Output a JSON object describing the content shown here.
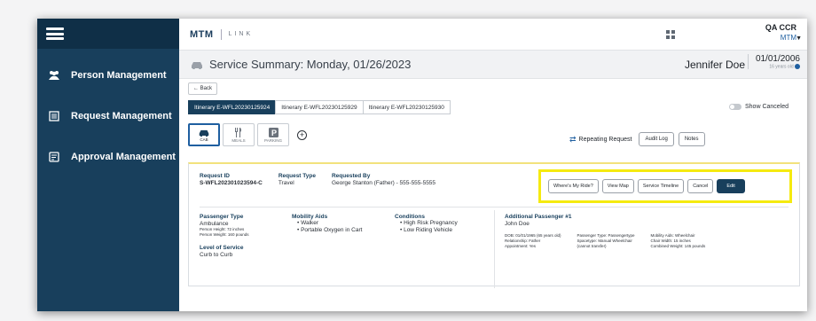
{
  "sidebar": {
    "items": [
      {
        "label": "Person Management",
        "icon": "people-icon"
      },
      {
        "label": "Request Management",
        "icon": "list-icon"
      },
      {
        "label": "Approval Management",
        "icon": "checklist-icon"
      }
    ]
  },
  "topbar": {
    "logo_brand": "MTM",
    "logo_product": "LINK",
    "user_name": "QA CCR",
    "user_org": "MTM"
  },
  "header": {
    "title": "Service Summary: Monday, 01/26/2023",
    "patient_name": "Jennifer Doe",
    "date": "01/01/2006",
    "age": "16 years old"
  },
  "back_label": "← Back",
  "tabs": [
    {
      "label": "Itinerary E-WFL20230125924",
      "active": true
    },
    {
      "label": "Itinerary E-WFL20230125929",
      "active": false
    },
    {
      "label": "Itinerary E-WFL20230125930",
      "active": false
    }
  ],
  "show_canceled_label": "Show Canceled",
  "services": [
    {
      "label": "CAB",
      "icon": "car-icon",
      "active": true
    },
    {
      "label": "MEALS",
      "icon": "utensils-icon",
      "active": false
    },
    {
      "label": "PARKING",
      "icon": "parking-icon",
      "active": false
    }
  ],
  "actions": {
    "repeating_request": "Repeating Request",
    "audit_log": "Audit Log",
    "notes": "Notes"
  },
  "request": {
    "id_label": "Request ID",
    "id_value": "S-WFL202301023594-C",
    "type_label": "Request Type",
    "type_value": "Travel",
    "requested_by_label": "Requested By",
    "requested_by_value": "George Stanton (Father) - 555-555-5555"
  },
  "highlighted_actions": {
    "wheres_my_ride": "Where's My Ride?",
    "view_map": "View Map",
    "service_timeline": "Service Timeline",
    "cancel": "Cancel",
    "edit": "Edit"
  },
  "details": {
    "passenger_type_label": "Passenger Type",
    "passenger_type_value": "Ambulance",
    "person_height": "Person Height: 72 inches",
    "person_weight": "Person Weight: 160 pounds",
    "level_of_service_label": "Level of Service",
    "level_of_service_value": "Curb to Curb",
    "mobility_aids_label": "Mobility Aids",
    "mobility_aids": [
      "• Walker",
      "• Portable Oxygen in Cart"
    ],
    "conditions_label": "Conditions",
    "conditions": [
      "• High Risk Pregnancy",
      "• Low Riding Vehicle"
    ]
  },
  "additional_passenger": {
    "label": "Additional Passenger #1",
    "name": "John Doe",
    "col1": [
      "DOB: 01/01/1965 (65 years old)",
      "Relationship: Father",
      "Appointment: Yes"
    ],
    "col2": [
      "Passenger Type: Passengertype",
      "Spacetype: Manual Wheelchair",
      "(cannot transfer)"
    ],
    "col3": [
      "Mobility Aids: Wheelchair",
      "Chair Width: 15 inches",
      "Combined Weight: 145 pounds"
    ]
  }
}
